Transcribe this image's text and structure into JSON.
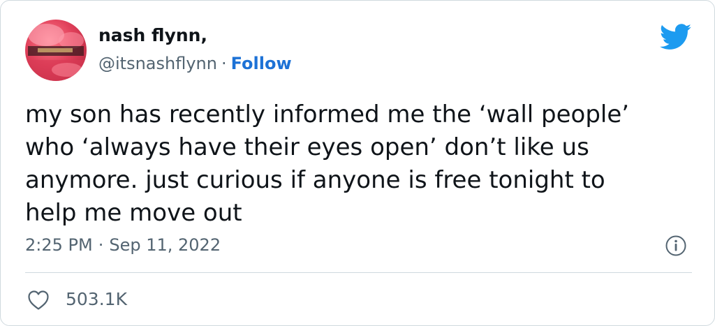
{
  "author": {
    "name": "nash flynn,",
    "handle": "@itsnashflynn",
    "separator": "·",
    "follow_label": "Follow"
  },
  "tweet": {
    "lines": [
      "my son has recently informed me the ‘wall people’",
      "who ‘always have their eyes open’ don’t like us",
      "anymore. just curious if anyone is free tonight to",
      "help me move out"
    ],
    "time": "2:25 PM",
    "separator": "·",
    "date": "Sep 11, 2022"
  },
  "stats": {
    "likes": "503.1K"
  },
  "icons": {
    "brand": "twitter-bird-icon",
    "info": "info-icon",
    "like": "heart-icon",
    "avatar": "avatar-photo"
  },
  "colors": {
    "text": "#0f1419",
    "secondary": "#536471",
    "follow": "#1d72d6",
    "brand": "#1d9bf0",
    "divider": "#cfd9de"
  }
}
